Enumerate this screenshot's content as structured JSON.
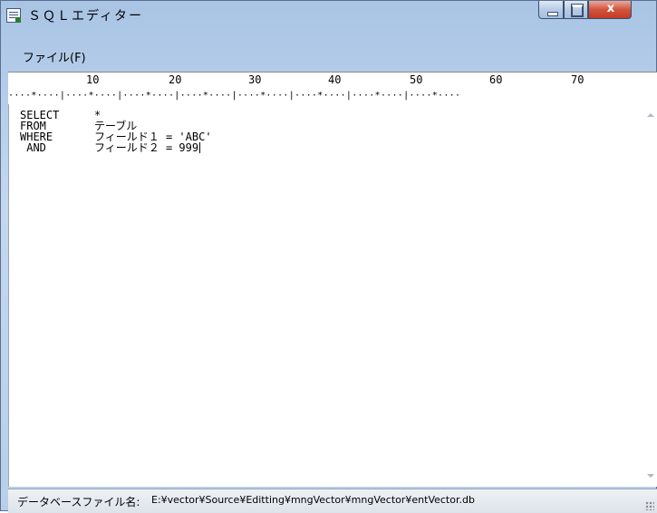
{
  "window": {
    "title": "ＳＱＬエディター",
    "close_glyph": "x"
  },
  "menu": {
    "file_label": "ファイル(F)"
  },
  "ruler": {
    "numbers": [
      "10",
      "20",
      "30",
      "40",
      "50",
      "60",
      "70"
    ],
    "ticks": "····*····|····*····|····*····|····*····|····*····|····*····|····*····|····*····"
  },
  "editor": {
    "lines": [
      {
        "keyword": "SELECT",
        "text": "*"
      },
      {
        "keyword": "FROM",
        "text": "テーブル"
      },
      {
        "keyword": "WHERE",
        "text": "フィールド１ = 'ABC'"
      },
      {
        "keyword": " AND",
        "text": "フィールド２ = 999"
      }
    ]
  },
  "statusbar": {
    "label": "データベースファイル名:",
    "path": "E:¥vector¥Source¥Editting¥mngVector¥mngVector¥entVector.db"
  },
  "colors": {
    "titlebar": "#b8cfe9",
    "close_button": "#c33b22",
    "editor_bg": "#ffffff"
  }
}
